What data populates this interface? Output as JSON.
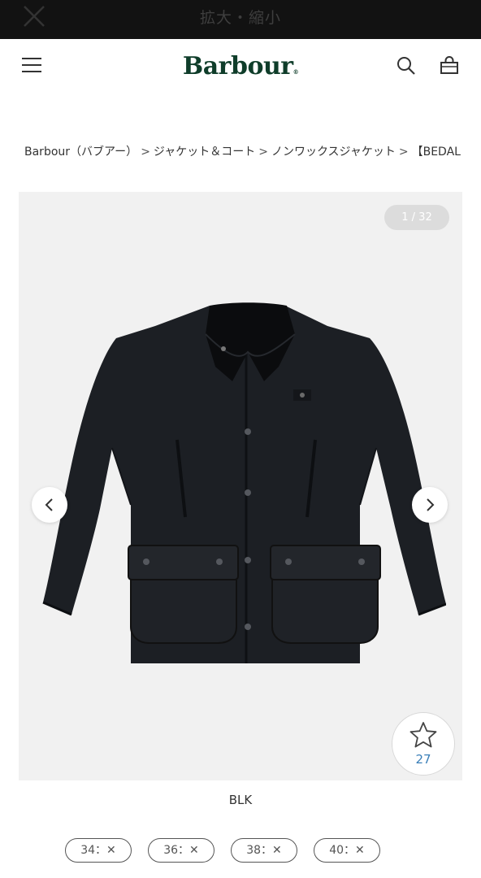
{
  "zoom_bar": {
    "title": "拡大・縮小"
  },
  "header": {
    "logo": "Barbour",
    "logo_mark": "®"
  },
  "breadcrumb": [
    "Barbour（バブアー）",
    "ジャケット＆コート",
    "ノンワックスジャケット",
    "【BEDAL"
  ],
  "gallery": {
    "counter": "1 / 32",
    "favorite_count": "27"
  },
  "product": {
    "color": "BLK"
  },
  "sizes": [
    {
      "label": "34：✕"
    },
    {
      "label": "36：✕"
    },
    {
      "label": "38：✕"
    },
    {
      "label": "40：✕"
    }
  ],
  "colors": {
    "logo": "#0f3d2a",
    "favorite_count": "#3a7fb8",
    "jacket": "#1c1f24"
  }
}
